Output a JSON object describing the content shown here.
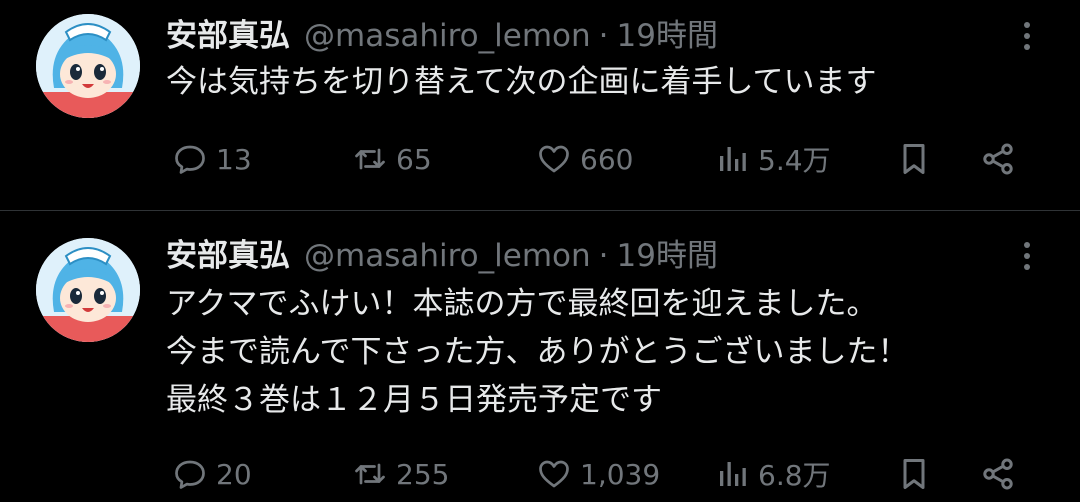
{
  "tweets": [
    {
      "name": "安部真弘",
      "handle": "@masahiro_lemon",
      "separator": "·",
      "time": "19時間",
      "lines": [
        "今は気持ちを切り替えて次の企画に着手しています"
      ],
      "replies": "13",
      "retweets": "65",
      "likes": "660",
      "views": "5.4万"
    },
    {
      "name": "安部真弘",
      "handle": "@masahiro_lemon",
      "separator": "·",
      "time": "19時間",
      "lines": [
        "アクマでふけい！本誌の方で最終回を迎えました。",
        "今まで読んで下さった方、ありがとうございました！",
        "最終３巻は１２月５日発売予定です"
      ],
      "replies": "20",
      "retweets": "255",
      "likes": "1,039",
      "views": "6.8万"
    }
  ],
  "icons": {
    "reply": "reply-icon",
    "retweet": "retweet-icon",
    "like": "heart-icon",
    "views": "views-icon",
    "bookmark": "bookmark-icon",
    "share": "share-icon",
    "more": "more-icon"
  },
  "colors": {
    "background": "#000000",
    "text": "#e7e9ea",
    "muted": "#71767b",
    "divider": "#2f3336"
  }
}
